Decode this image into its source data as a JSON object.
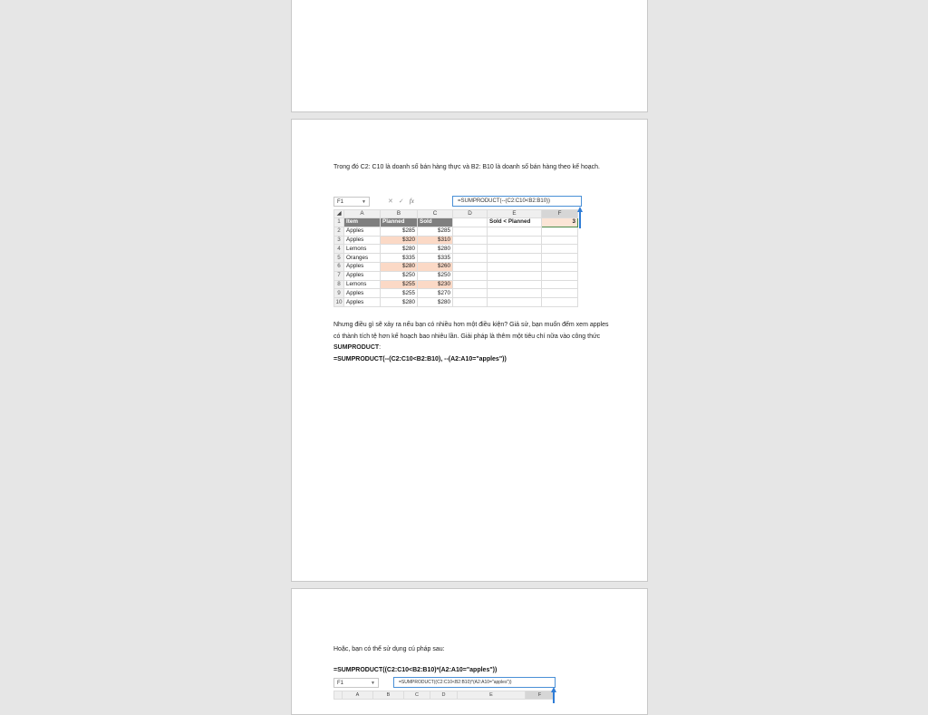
{
  "page2": {
    "paragraph1": "Trong đó C2: C10 là doanh số bán hàng thực và B2: B10 là doanh số bán hàng theo kế hoạch.",
    "excel": {
      "name_box": "F1",
      "formula": "=SUMPRODUCT(--(C2:C10<B2:B10))",
      "columns": [
        "A",
        "B",
        "C",
        "D",
        "E",
        "F"
      ],
      "header_row": [
        "Item",
        "Planned",
        "Sold",
        "",
        "Sold < Planned",
        "3"
      ],
      "rows": [
        {
          "num": "2",
          "item": "Apples",
          "planned": "$285",
          "sold": "$285",
          "hl": false
        },
        {
          "num": "3",
          "item": "Apples",
          "planned": "$320",
          "sold": "$310",
          "hl": true
        },
        {
          "num": "4",
          "item": "Lemons",
          "planned": "$280",
          "sold": "$280",
          "hl": false
        },
        {
          "num": "5",
          "item": "Oranges",
          "planned": "$335",
          "sold": "$335",
          "hl": false
        },
        {
          "num": "6",
          "item": "Apples",
          "planned": "$280",
          "sold": "$260",
          "hl": true
        },
        {
          "num": "7",
          "item": "Apples",
          "planned": "$250",
          "sold": "$250",
          "hl": false
        },
        {
          "num": "8",
          "item": "Lemons",
          "planned": "$255",
          "sold": "$230",
          "hl": true
        },
        {
          "num": "9",
          "item": "Apples",
          "planned": "$255",
          "sold": "$270",
          "hl": false
        },
        {
          "num": "10",
          "item": "Apples",
          "planned": "$280",
          "sold": "$280",
          "hl": false
        }
      ]
    },
    "paragraph2_text": "Nhưng điều gì sẽ xảy ra nếu bạn có nhiều hơn một điều kiện? Giả sử, bạn muốn đếm xem apples có thành tích tệ hơn kế hoạch bao nhiêu lần. Giải pháp là thêm một tiêu chí nữa vào công thức ",
    "paragraph2_bold": "SUMPRODUCT",
    "paragraph2_end": ":",
    "formula2": "=SUMPRODUCT(--(C2:C10<B2:B10), --(A2:A10=\"apples\"))"
  },
  "page3": {
    "paragraph": "Hoặc, bạn có thể sử dụng cú pháp sau:",
    "formula": "=SUMPRODUCT((C2:C10<B2:B10)*(A2:A10=\"apples\"))",
    "excel": {
      "name_box": "F1",
      "formula": "=SUMPRODUCT((C2:C10<B2:B10)*(A2:A10=\"apples\"))",
      "columns": [
        "A",
        "B",
        "C",
        "D",
        "E",
        "F"
      ]
    }
  }
}
